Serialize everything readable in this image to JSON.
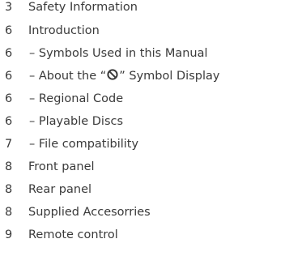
{
  "toc": {
    "entries": [
      {
        "page": "3",
        "title": "Safety Information"
      },
      {
        "page": "6",
        "title": "Introduction"
      },
      {
        "page": "6",
        "title": "– Symbols Used in this Manual"
      },
      {
        "page": "6",
        "title_prefix": "– About the “",
        "icon": "prohibited-circle-slash-icon",
        "title_suffix": "” Symbol Display"
      },
      {
        "page": "6",
        "title": "– Regional Code"
      },
      {
        "page": "6",
        "title": "– Playable Discs"
      },
      {
        "page": "7",
        "title": "– File compatibility"
      },
      {
        "page": "8",
        "title": "Front panel"
      },
      {
        "page": "8",
        "title": "Rear panel"
      },
      {
        "page": "8",
        "title": "Supplied Accesorries"
      },
      {
        "page": "9",
        "title": "Remote control"
      }
    ]
  }
}
